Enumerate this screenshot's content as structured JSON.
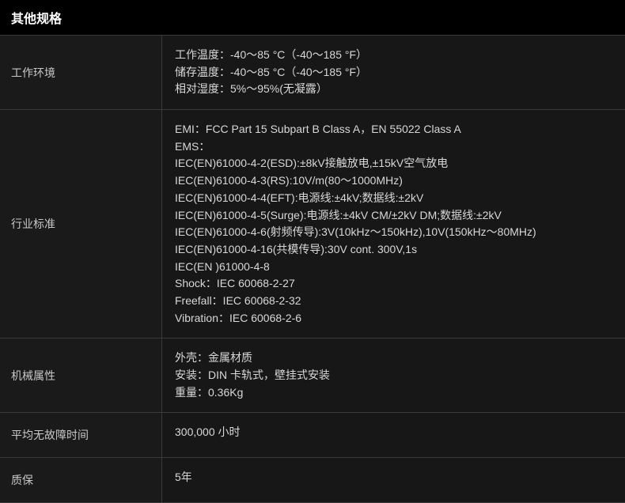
{
  "header": "其他规格",
  "rows": [
    {
      "label": "工作环境",
      "lines": [
        "工作温度：-40～85 °C（-40～185 °F）",
        "储存温度：-40～85 °C（-40～185 °F）",
        "相对湿度：5%～95%(无凝露）"
      ]
    },
    {
      "label": "行业标准",
      "lines": [
        "EMI：FCC Part 15 Subpart B Class A，EN 55022 Class A",
        "EMS：",
        "IEC(EN)61000-4-2(ESD):±8kV接触放电,±15kV空气放电",
        "IEC(EN)61000-4-3(RS):10V/m(80～1000MHz)",
        "IEC(EN)61000-4-4(EFT):电源线:±4kV;数据线:±2kV",
        "IEC(EN)61000-4-5(Surge):电源线:±4kV CM/±2kV DM;数据线:±2kV",
        "IEC(EN)61000-4-6(射频传导):3V(10kHz～150kHz),10V(150kHz～80MHz)",
        "IEC(EN)61000-4-16(共模传导):30V cont. 300V,1s",
        "IEC(EN )61000-4-8",
        "Shock：IEC 60068-2-27",
        "Freefall：IEC 60068-2-32",
        "Vibration：IEC 60068-2-6"
      ]
    },
    {
      "label": "机械属性",
      "lines": [
        "外壳：金属材质",
        "安装：DIN 卡轨式，壁挂式安装",
        "重量：0.36Kg"
      ]
    },
    {
      "label": "平均无故障时间",
      "lines": [
        "300,000 小时"
      ]
    },
    {
      "label": "质保",
      "lines": [
        "5年"
      ]
    }
  ]
}
